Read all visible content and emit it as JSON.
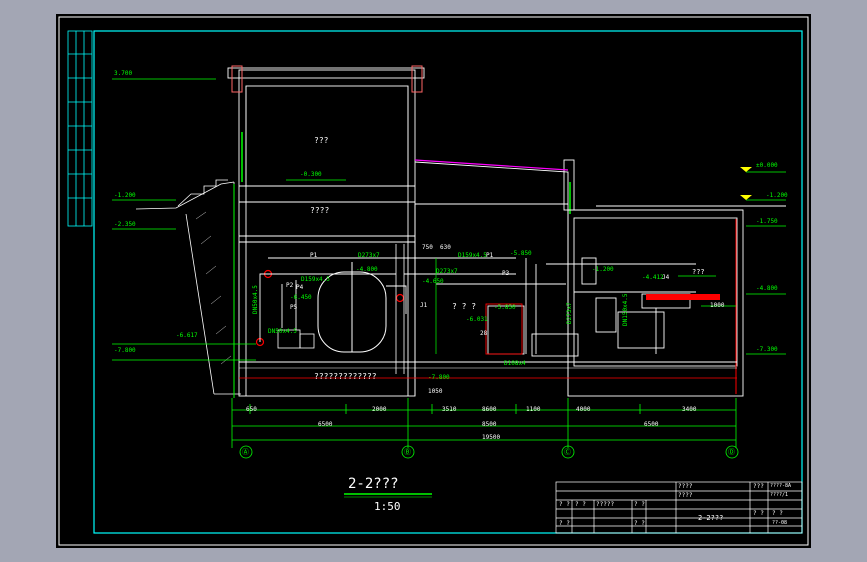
{
  "drawing": {
    "title": "2-2???",
    "scale": "1:50"
  },
  "rooms": {
    "upper": "???",
    "middle": "????",
    "pump_room": "? ? ?",
    "basement_label": "?????????????",
    "right_tag": "???"
  },
  "elevations": {
    "roof": "3.700",
    "ground_right": "±0.000",
    "l1": "-1.200",
    "l2": "-2.350",
    "l3": "-0.300",
    "l4": "-6.617",
    "l5": "-7.800",
    "r1": "-1.200",
    "r2": "-1.750",
    "r3": "-4.800",
    "r4": "-7.300",
    "r_low": "-7.800",
    "pipe_a": "-5.850",
    "pipe_b": "-4.800",
    "pipe_c": "-4.650",
    "pipe_d": "-4.412",
    "pipe_e": "-1.200",
    "pipe_f": "-6.450",
    "pipe_g": "-6.031",
    "pipe_h": "-5.850"
  },
  "pipes": {
    "p1": "DN50x4.5",
    "p2": "D273x7",
    "p3": "D159x4.5",
    "p4": "D273x7",
    "p5": "D159x4.5",
    "p6": "DN50x4.5",
    "p7": "D273x7",
    "p8": "D108x4",
    "p9": "DN150x4.5",
    "tags": [
      "P1",
      "P3",
      "P4",
      "P5",
      "P1",
      "P2",
      "28",
      "J1",
      "J4"
    ]
  },
  "dimensions": {
    "row1": [
      "650",
      "2000",
      "3510",
      "8600",
      "1100",
      "4000",
      "3400"
    ],
    "row2": [
      "6500",
      "8500",
      "6500"
    ],
    "total": "19500",
    "bottom_small": "1050",
    "right_top": "750",
    "right_mid": "630",
    "sec_top": "700",
    "sec_right": "1000"
  },
  "axes": [
    "Ⓐ",
    "Ⓑ",
    "Ⓒ",
    "Ⓓ"
  ],
  "title_block": {
    "r1": [
      "????",
      "",
      "",
      "",
      "???",
      "????-8A"
    ],
    "r2": [
      "????",
      "",
      "",
      "",
      "",
      "????/1"
    ],
    "name": "2-2???",
    "cells": [
      "? ?",
      "? ?",
      "?????",
      "? ?",
      "? ?",
      "? ?"
    ],
    "drawno": "??-08",
    "extra": [
      "? ?",
      "? ?"
    ]
  },
  "colors": {
    "border": "#00ffff",
    "frame": "#ffffff",
    "green": "#00ff00",
    "red": "#ff0000",
    "magenta": "#ff00ff",
    "yellow": "#ffff00"
  }
}
